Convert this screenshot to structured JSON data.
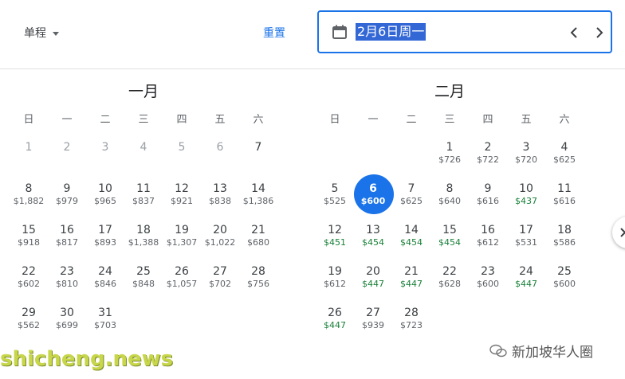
{
  "header": {
    "trip_type": "单程",
    "reset_label": "重置",
    "date_value": "2月6日周一",
    "icons": {
      "calendar": "calendar-icon",
      "prev": "chevron-left-icon",
      "next": "chevron-right-icon",
      "dropdown": "caret-down-icon"
    }
  },
  "months": [
    {
      "title": "一月",
      "weekdays": [
        "日",
        "一",
        "二",
        "三",
        "四",
        "五",
        "六"
      ],
      "leading_blanks": 0,
      "days": [
        {
          "d": "1",
          "p": "",
          "state": "past"
        },
        {
          "d": "2",
          "p": "",
          "state": "past"
        },
        {
          "d": "3",
          "p": "",
          "state": "past"
        },
        {
          "d": "4",
          "p": "",
          "state": "past"
        },
        {
          "d": "5",
          "p": "",
          "state": "past"
        },
        {
          "d": "6",
          "p": "",
          "state": "past"
        },
        {
          "d": "7",
          "p": "",
          "state": ""
        },
        {
          "d": "8",
          "p": "$1,882",
          "state": ""
        },
        {
          "d": "9",
          "p": "$979",
          "state": ""
        },
        {
          "d": "10",
          "p": "$965",
          "state": ""
        },
        {
          "d": "11",
          "p": "$837",
          "state": ""
        },
        {
          "d": "12",
          "p": "$921",
          "state": ""
        },
        {
          "d": "13",
          "p": "$838",
          "state": ""
        },
        {
          "d": "14",
          "p": "$1,386",
          "state": ""
        },
        {
          "d": "15",
          "p": "$918",
          "state": ""
        },
        {
          "d": "16",
          "p": "$817",
          "state": ""
        },
        {
          "d": "17",
          "p": "$893",
          "state": ""
        },
        {
          "d": "18",
          "p": "$1,388",
          "state": ""
        },
        {
          "d": "19",
          "p": "$1,307",
          "state": ""
        },
        {
          "d": "20",
          "p": "$1,022",
          "state": ""
        },
        {
          "d": "21",
          "p": "$680",
          "state": ""
        },
        {
          "d": "22",
          "p": "$602",
          "state": ""
        },
        {
          "d": "23",
          "p": "$810",
          "state": ""
        },
        {
          "d": "24",
          "p": "$846",
          "state": ""
        },
        {
          "d": "25",
          "p": "$848",
          "state": ""
        },
        {
          "d": "26",
          "p": "$1,057",
          "state": ""
        },
        {
          "d": "27",
          "p": "$702",
          "state": ""
        },
        {
          "d": "28",
          "p": "$756",
          "state": ""
        },
        {
          "d": "29",
          "p": "$562",
          "state": ""
        },
        {
          "d": "30",
          "p": "$699",
          "state": ""
        },
        {
          "d": "31",
          "p": "$703",
          "state": ""
        }
      ]
    },
    {
      "title": "二月",
      "weekdays": [
        "日",
        "一",
        "二",
        "三",
        "四",
        "五",
        "六"
      ],
      "leading_blanks": 3,
      "days": [
        {
          "d": "1",
          "p": "$726",
          "state": ""
        },
        {
          "d": "2",
          "p": "$722",
          "state": ""
        },
        {
          "d": "3",
          "p": "$720",
          "state": ""
        },
        {
          "d": "4",
          "p": "$625",
          "state": ""
        },
        {
          "d": "5",
          "p": "$525",
          "state": ""
        },
        {
          "d": "6",
          "p": "$600",
          "state": "selected"
        },
        {
          "d": "7",
          "p": "$625",
          "state": ""
        },
        {
          "d": "8",
          "p": "$640",
          "state": ""
        },
        {
          "d": "9",
          "p": "$616",
          "state": ""
        },
        {
          "d": "10",
          "p": "$437",
          "state": "cheap"
        },
        {
          "d": "11",
          "p": "$616",
          "state": ""
        },
        {
          "d": "12",
          "p": "$451",
          "state": "cheap"
        },
        {
          "d": "13",
          "p": "$454",
          "state": "cheap"
        },
        {
          "d": "14",
          "p": "$454",
          "state": "cheap"
        },
        {
          "d": "15",
          "p": "$454",
          "state": "cheap"
        },
        {
          "d": "16",
          "p": "$612",
          "state": ""
        },
        {
          "d": "17",
          "p": "$531",
          "state": ""
        },
        {
          "d": "18",
          "p": "$586",
          "state": ""
        },
        {
          "d": "19",
          "p": "$612",
          "state": ""
        },
        {
          "d": "20",
          "p": "$447",
          "state": "cheap"
        },
        {
          "d": "21",
          "p": "$447",
          "state": "cheap"
        },
        {
          "d": "22",
          "p": "$628",
          "state": ""
        },
        {
          "d": "23",
          "p": "$600",
          "state": ""
        },
        {
          "d": "24",
          "p": "$447",
          "state": "cheap"
        },
        {
          "d": "25",
          "p": "$600",
          "state": ""
        },
        {
          "d": "26",
          "p": "$447",
          "state": "cheap"
        },
        {
          "d": "27",
          "p": "$939",
          "state": ""
        },
        {
          "d": "28",
          "p": "$723",
          "state": ""
        }
      ]
    }
  ],
  "overlay": {
    "watermark": "shicheng.news",
    "wechat_account": "新加坡华人圈"
  },
  "colors": {
    "accent": "#1a73e8",
    "cheap": "#188038",
    "selection_highlight": "#3367d6"
  }
}
